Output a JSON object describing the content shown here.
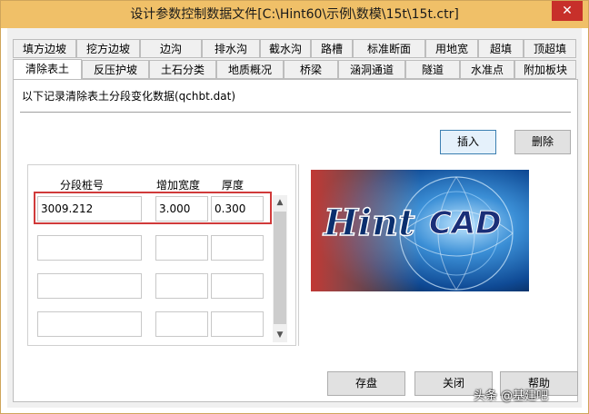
{
  "window": {
    "title": "设计参数控制数据文件[C:\\Hint60\\示例\\数模\\15t\\15t.ctr]",
    "close_glyph": "✕"
  },
  "tabs_row1": [
    "填方边坡",
    "挖方边坡",
    "边沟",
    "排水沟",
    "截水沟",
    "路槽",
    "标准断面",
    "用地宽",
    "超填",
    "顶超填"
  ],
  "tabs_row2": [
    "清除表土",
    "反压护坡",
    "土石分类",
    "地质概况",
    "桥梁",
    "涵洞通道",
    "隧道",
    "水准点",
    "附加板块"
  ],
  "active_tab": "清除表土",
  "panel": {
    "description": "以下记录清除表土分段变化数据(qchbt.dat)",
    "insert_label": "插入",
    "delete_label": "删除"
  },
  "table": {
    "headers": [
      "分段桩号",
      "增加宽度",
      "厚度"
    ],
    "rows": [
      [
        "3009.212",
        "3.000",
        "0.300"
      ],
      [
        "",
        "",
        ""
      ],
      [
        "",
        "",
        ""
      ],
      [
        "",
        "",
        ""
      ]
    ]
  },
  "logo": {
    "text_hint": "Hint",
    "text_cad": "CAD"
  },
  "footer": {
    "save_label": "存盘",
    "close_label": "关闭",
    "help_label": "帮助"
  },
  "watermark": "头条 @基建吧",
  "colors": {
    "titlebar": "#f0c068",
    "close": "#c7302a",
    "highlight": "#d03a3a"
  }
}
